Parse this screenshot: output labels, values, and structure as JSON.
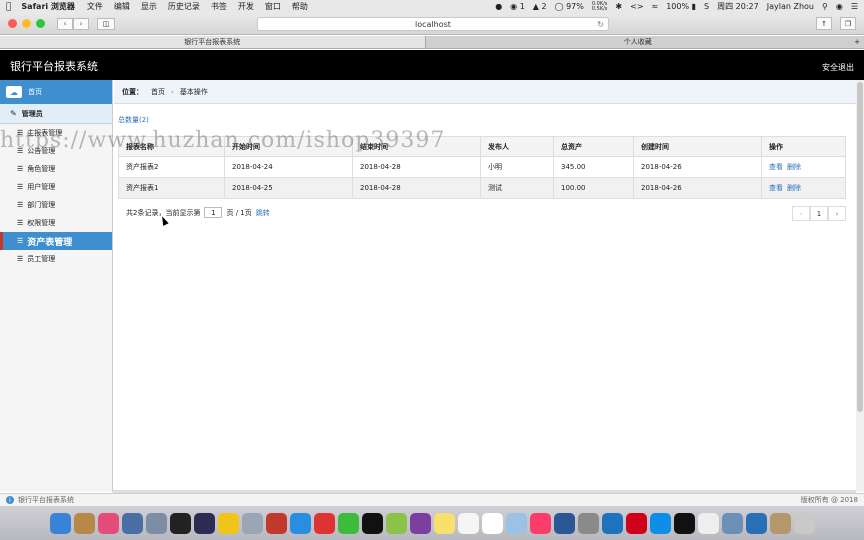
{
  "macos": {
    "app_name": "Safari 浏览器",
    "menus": [
      "文件",
      "编辑",
      "显示",
      "历史记录",
      "书签",
      "开发",
      "窗口",
      "帮助"
    ],
    "status": {
      "qq_count": "1",
      "notify_count": "2",
      "cpu": "97%",
      "net_up": "0.0K/s",
      "net_down": "0.5K/s",
      "battery": "100%",
      "time": "周四 20:27",
      "user": "Jaylan Zhou"
    }
  },
  "browser": {
    "url": "localhost",
    "tabs": [
      "银行平台报表系统",
      "个人收藏"
    ]
  },
  "app": {
    "title": "银行平台报表系统",
    "logout": "安全退出",
    "sidebar": {
      "home": "首页",
      "section": "管理员",
      "items": [
        "主报表管理",
        "公告管理",
        "角色管理",
        "用户管理",
        "部门管理",
        "权限管理",
        "资产表管理",
        "员工管理"
      ]
    },
    "breadcrumb": {
      "label": "位置：",
      "home": "首页",
      "current": "基本操作"
    },
    "total": "总数量(2)",
    "table": {
      "headers": [
        "报表名称",
        "开始时间",
        "结束时间",
        "发布人",
        "总资产",
        "创建时间",
        "操作"
      ],
      "rows": [
        {
          "name": "资产报表2",
          "start": "2018-04-24",
          "end": "2018-04-28",
          "publisher": "小明",
          "assets": "345.00",
          "created": "2018-04-26",
          "view": "查看",
          "delete": "删除"
        },
        {
          "name": "资产报表1",
          "start": "2018-04-25",
          "end": "2018-04-28",
          "publisher": "测试",
          "assets": "100.00",
          "created": "2018-04-26",
          "view": "查看",
          "delete": "删除"
        }
      ]
    },
    "pagination": {
      "summary_prefix": "共2条记录，当前显示第",
      "page_value": "1",
      "summary_suffix": "页 / 1页",
      "jump": "跳转",
      "prev": "‹",
      "current": "1",
      "next": "›"
    },
    "watermark": "https://www.huzhan.com/ishop39397",
    "footer": {
      "left": "银行平台报表系统",
      "right": "版权所有 @ 2018"
    }
  }
}
